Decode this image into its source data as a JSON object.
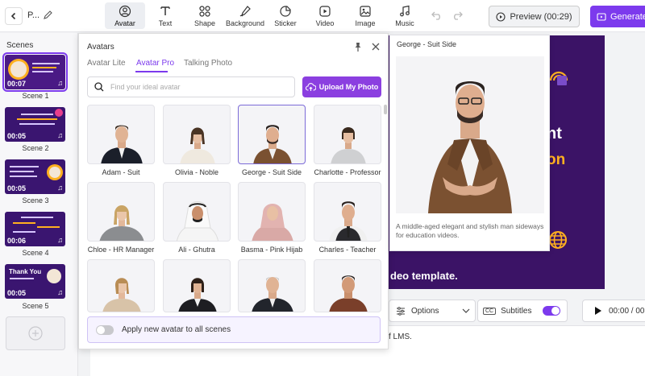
{
  "topbar": {
    "project_name": "P...",
    "tools": [
      {
        "label": "Avatar",
        "icon": "avatar-icon"
      },
      {
        "label": "Text",
        "icon": "text-icon"
      },
      {
        "label": "Shape",
        "icon": "shape-icon"
      },
      {
        "label": "Background",
        "icon": "background-icon"
      },
      {
        "label": "Sticker",
        "icon": "sticker-icon"
      },
      {
        "label": "Video",
        "icon": "video-icon"
      },
      {
        "label": "Image",
        "icon": "image-icon"
      },
      {
        "label": "Music",
        "icon": "music-icon"
      }
    ],
    "preview_label": "Preview (00:29)",
    "generate_label": "Generate"
  },
  "scenes": {
    "title": "Scenes",
    "items": [
      {
        "label": "Scene 1",
        "duration": "00:07"
      },
      {
        "label": "Scene 2",
        "duration": "00:05"
      },
      {
        "label": "Scene 3",
        "duration": "00:05"
      },
      {
        "label": "Scene 4",
        "duration": "00:06"
      },
      {
        "label": "Scene 5",
        "duration": "00:05"
      }
    ],
    "scene5_text": "Thank You"
  },
  "canvas": {
    "line1": "nt",
    "line2": "on",
    "footer": "deo template."
  },
  "controls": {
    "options_label": "Options",
    "cc_badge": "CC",
    "subtitles_label": "Subtitles",
    "time": "00:00 / 00"
  },
  "script_text": "f LMS.",
  "avatars_panel": {
    "title": "Avatars",
    "tabs": [
      "Avatar Lite",
      "Avatar Pro",
      "Talking Photo"
    ],
    "active_tab": "Avatar Pro",
    "search_placeholder": "Find your ideal avatar",
    "upload_label": "Upload My Photo",
    "avatars": [
      {
        "name": "Adam - Suit"
      },
      {
        "name": "Olivia - Noble"
      },
      {
        "name": "George - Suit Side"
      },
      {
        "name": "Charlotte - Professor"
      },
      {
        "name": "Chloe - HR Manager"
      },
      {
        "name": "Ali - Ghutra"
      },
      {
        "name": "Basma - Pink Hijab"
      },
      {
        "name": "Charles - Teacher"
      },
      {
        "name": ""
      },
      {
        "name": ""
      },
      {
        "name": ""
      },
      {
        "name": ""
      }
    ],
    "apply_all_label": "Apply new avatar to all scenes"
  },
  "preview_popup": {
    "title": "George - Suit Side",
    "description": "A middle-aged elegant and stylish man sideways for education videos."
  },
  "colors": {
    "accent": "#7c3aed",
    "canvas_bg": "#3b1366",
    "highlight": "#ffb020"
  }
}
